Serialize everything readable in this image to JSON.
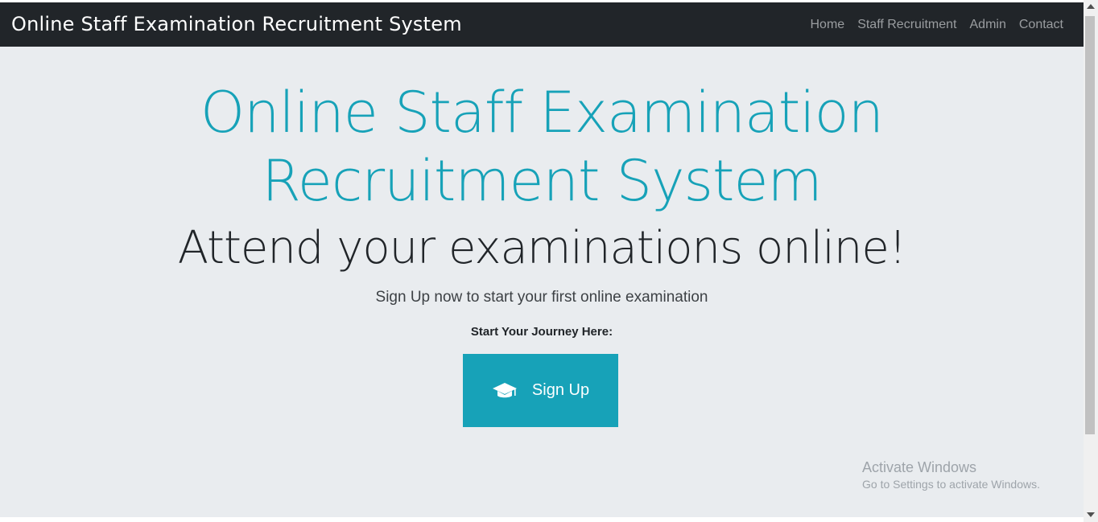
{
  "navbar": {
    "brand": "Online Staff Examination Recruitment System",
    "links": [
      "Home",
      "Staff Recruitment",
      "Admin",
      "Contact"
    ]
  },
  "hero": {
    "title_line1": "Online Staff Examination",
    "title_line2": "Recruitment System",
    "subtitle": "Attend your examinations online!",
    "lead": "Sign Up now to start your first online examination",
    "journey_label": "Start Your Journey Here:",
    "signup_label": "Sign Up",
    "signup_icon": "graduation-cap-icon"
  },
  "watermark": {
    "title": "Activate Windows",
    "subtitle": "Go to Settings to activate Windows."
  },
  "colors": {
    "navbar_bg": "#212529",
    "jumbotron_bg": "#e9ecef",
    "accent": "#17a2b8",
    "nav_link": "#9a9da0"
  }
}
